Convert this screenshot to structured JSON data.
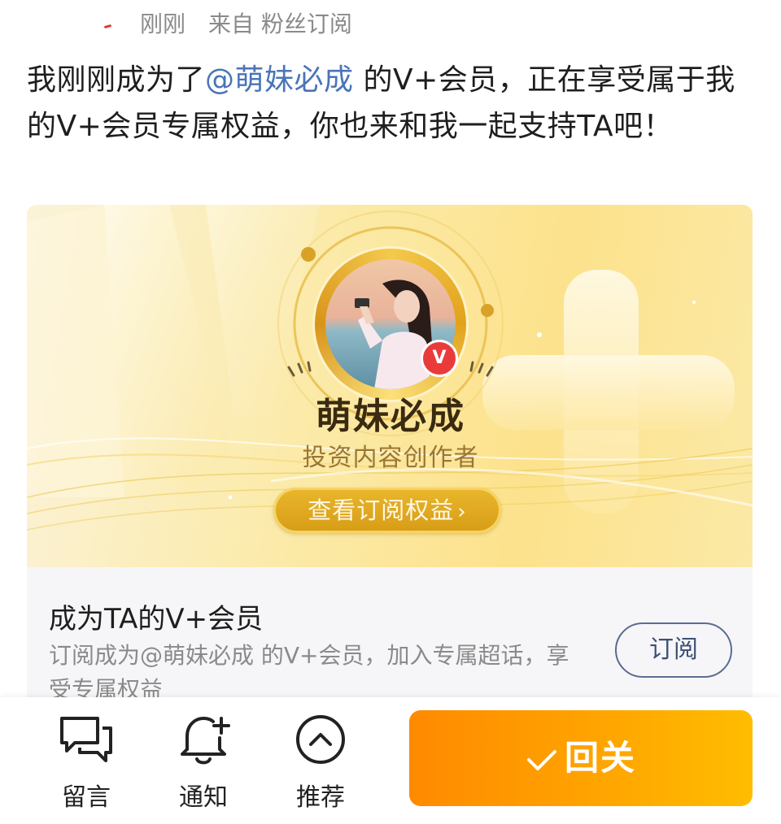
{
  "post_meta": {
    "time": "刚刚",
    "source": "来自 粉丝订阅"
  },
  "post": {
    "text_before": "我刚刚成为了",
    "mention": "@萌妹必成",
    "text_after": " 的V+会员，正在享受属于我的V+会员专属权益，你也来和我一起支持TA吧！"
  },
  "card": {
    "creator_name": "萌妹必成",
    "creator_role": "投资内容创作者",
    "badge_letter": "V",
    "benefits_button": "查看订阅权益",
    "benefits_chevron": "›"
  },
  "subscribe": {
    "title": "成为TA的V+会员",
    "description": "订阅成为@萌妹必成 的V+会员，加入专属超话，享受专属权益",
    "button": "订阅"
  },
  "toolbar": {
    "comment_label": "留言",
    "notify_label": "通知",
    "recommend_label": "推荐",
    "follow_label": "回关"
  },
  "colors": {
    "mention": "#4a74b8",
    "follow_button": "#ff9800",
    "badge": "#ea3b3b",
    "card_gold": "#fce28c"
  },
  "icons": {
    "comment": "speech-bubbles-icon",
    "notify": "bell-plus-icon",
    "recommend": "chevron-up-circle-icon",
    "follow": "checkmark-icon",
    "badge": "v-member-badge-icon"
  }
}
